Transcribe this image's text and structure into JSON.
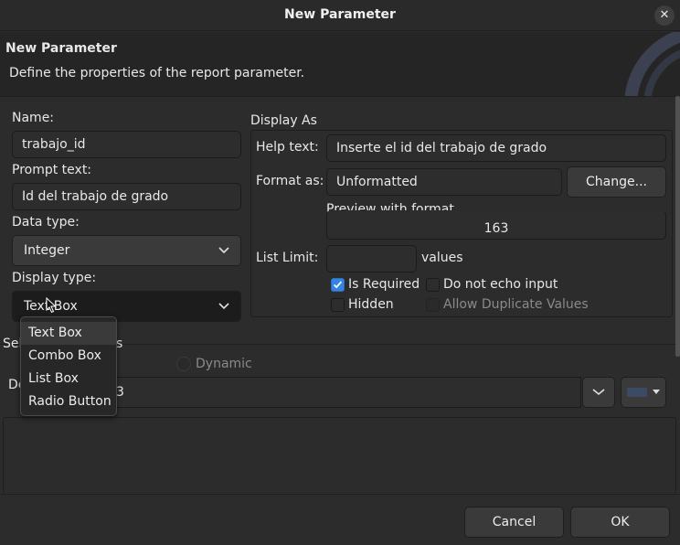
{
  "window": {
    "title": "New Parameter",
    "close_glyph": "✕"
  },
  "banner": {
    "title": "New Parameter",
    "description": "Define the properties of the report parameter."
  },
  "left": {
    "name_label": "Name:",
    "name_value": "trabajo_id",
    "prompt_label": "Prompt text:",
    "prompt_value": "Id del trabajo de grado",
    "datatype_label": "Data type:",
    "datatype_value": "Integer",
    "displaytype_label": "Display type:",
    "displaytype_value": "Text Box"
  },
  "display_as": {
    "title": "Display As",
    "help_label": "Help text:",
    "help_value": "Inserte el id del trabajo de grado",
    "format_label": "Format as:",
    "format_value": "Unformatted",
    "change_button": "Change...",
    "preview_label": "Preview with format",
    "preview_value": "163",
    "listlimit_label": "List Limit:",
    "listlimit_value": "",
    "values_label": "values",
    "is_required": "Is Required",
    "do_not_echo": "Do not echo input",
    "hidden": "Hidden",
    "allow_duplicates": "Allow Duplicate Values"
  },
  "selection": {
    "label_fragment": "Sel",
    "label_tail": "s",
    "dynamic_label": "Dynamic",
    "default_fragment": "De",
    "default_value_fragment": "3"
  },
  "dropdown": {
    "options": [
      "Text Box",
      "Combo Box",
      "List Box",
      "Radio Button"
    ],
    "hovered_index": 0
  },
  "footer": {
    "cancel": "Cancel",
    "ok": "OK"
  },
  "colors": {
    "accent": "#3584e4",
    "background": "#2c2c2c"
  }
}
